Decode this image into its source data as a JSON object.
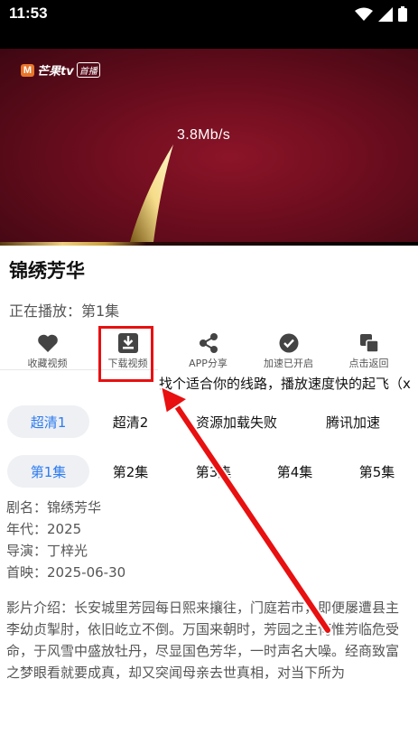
{
  "status_bar": {
    "time": "11:53",
    "icons": [
      "wifi-icon",
      "signal-icon",
      "battery-icon"
    ]
  },
  "player": {
    "logo_text": "芒果tv",
    "logo_tag": "首播",
    "speed": "3.8Mb/s"
  },
  "title": "锦绣芳华",
  "now_playing": "正在播放：第1集",
  "actions": [
    {
      "label": "收藏视频",
      "icon": "heart-icon"
    },
    {
      "label": "下载视频",
      "icon": "download-icon"
    },
    {
      "label": "APP分享",
      "icon": "share-icon"
    },
    {
      "label": "加速已开启",
      "icon": "check-circle-icon"
    },
    {
      "label": "点击返回",
      "icon": "return-icon"
    }
  ],
  "marquee": "找个适合你的线路，播放速度快的起飞（x",
  "lines": [
    {
      "label": "超清1",
      "active": true
    },
    {
      "label": "超清2",
      "active": false
    },
    {
      "label": "资源加载失败",
      "active": false
    },
    {
      "label": "腾讯加速",
      "active": false
    }
  ],
  "episodes": [
    {
      "label": "第1集",
      "active": true
    },
    {
      "label": "第2集",
      "active": false
    },
    {
      "label": "第3集",
      "active": false
    },
    {
      "label": "第4集",
      "active": false
    },
    {
      "label": "第5集",
      "active": false
    }
  ],
  "info": {
    "name": "剧名：锦绣芳华",
    "year": "年代：2025",
    "director": "导演：丁梓光",
    "premiere": "首映：2025-06-30"
  },
  "intro": "影片介绍：长安城里芳园每日熙来攘往，门庭若市，即便屡遭县主李幼贞掣肘，依旧屹立不倒。万国来朝时，芳园之主何惟芳临危受命，于风雪中盛放牡丹，尽显国色芳华，一时声名大噪。经商致富之梦眼看就要成真，却又突闻母亲去世真相，对当下所为",
  "colors": {
    "accent": "#2d7cf0",
    "highlight": "#e81010",
    "video_bg": "#6b0d1e"
  }
}
